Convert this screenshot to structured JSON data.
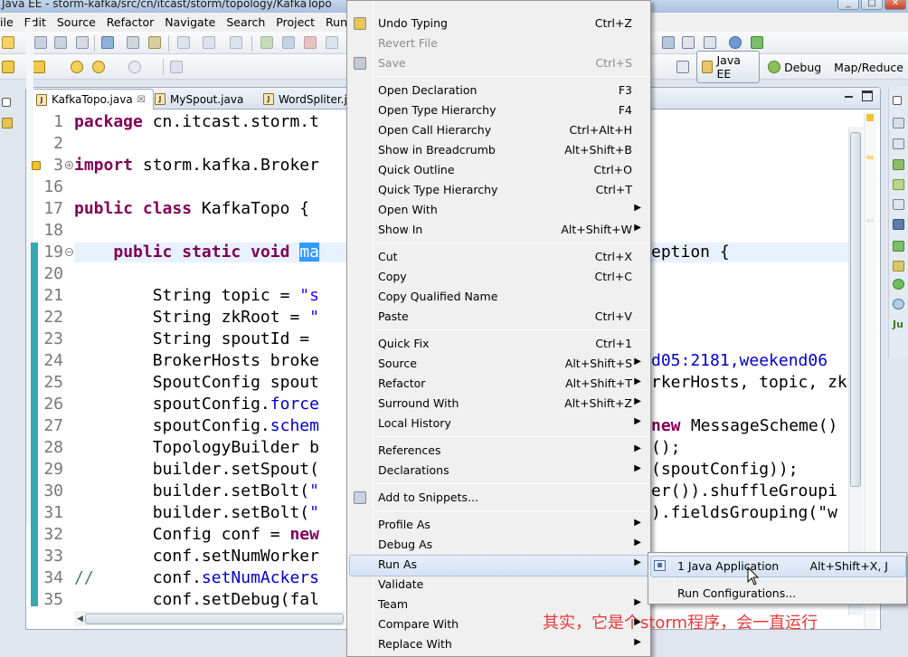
{
  "window": {
    "title": "Java EE - storm-kafka/src/cn/itcast/storm/topology/KafkaTopo"
  },
  "menubar": [
    "ile",
    "Edit",
    "Source",
    "Refactor",
    "Navigate",
    "Search",
    "Project",
    "Run"
  ],
  "perspectives": [
    {
      "label": "Java EE",
      "active": true,
      "icon": "java-ee-perspective-icon"
    },
    {
      "label": "Debug",
      "active": false,
      "icon": "debug-perspective-icon"
    },
    {
      "label": "Map/Reduce",
      "active": false,
      "icon": ""
    }
  ],
  "tabs": [
    {
      "label": "KafkaTopo.java",
      "active": true,
      "close": "☒"
    },
    {
      "label": "MySpout.java",
      "active": false
    },
    {
      "label": "WordSpliter.jav",
      "active": false
    }
  ],
  "editor": {
    "lines": [
      {
        "n": "1",
        "text": "package cn.itcast.storm.t"
      },
      {
        "n": "2",
        "text": ""
      },
      {
        "n": "3",
        "text": "import storm.kafka.Broker"
      },
      {
        "n": "16",
        "text": ""
      },
      {
        "n": "17",
        "text": "public class KafkaTopo {"
      },
      {
        "n": "18",
        "text": ""
      },
      {
        "n": "19",
        "text": "    public static void ma"
      },
      {
        "n": "20",
        "text": ""
      },
      {
        "n": "21",
        "text": "        String topic = \"s"
      },
      {
        "n": "22",
        "text": "        String zkRoot = \""
      },
      {
        "n": "23",
        "text": "        String spoutId = "
      },
      {
        "n": "24",
        "text": "        BrokerHosts broke"
      },
      {
        "n": "25",
        "text": "        SpoutConfig spout"
      },
      {
        "n": "26",
        "text": "        spoutConfig.force"
      },
      {
        "n": "27",
        "text": "        spoutConfig.schem"
      },
      {
        "n": "28",
        "text": "        TopologyBuilder b"
      },
      {
        "n": "29",
        "text": "        builder.setSpout("
      },
      {
        "n": "30",
        "text": "        builder.setBolt(\""
      },
      {
        "n": "31",
        "text": "        builder.setBolt(\""
      },
      {
        "n": "32",
        "text": "        Config conf = new"
      },
      {
        "n": "33",
        "text": "        conf.setNumWorker"
      },
      {
        "n": "34",
        "text": "//      conf.setNumAckers"
      },
      {
        "n": "35",
        "text": "        conf.setDebug(fal"
      }
    ],
    "right_fragments": {
      "l19": "eption {",
      "l24": "d05:2181,weekend06",
      "l25": "rkerHosts, topic, zk",
      "l27_kw": "new",
      "l27": " MessageScheme()",
      "l28": "();",
      "l29": "(spoutConfig));",
      "l30": "er()).shuffleGroupi",
      "l31": ").fieldsGrouping(\"w"
    }
  },
  "context_menu": {
    "items": [
      {
        "label": "Undo Typing",
        "accel": "Ctrl+Z",
        "icon": "undo-icon"
      },
      {
        "label": "Revert File",
        "disabled": true
      },
      {
        "label": "Save",
        "accel": "Ctrl+S",
        "disabled": true,
        "icon": "save-icon"
      },
      {
        "sep": true
      },
      {
        "label": "Open Declaration",
        "accel": "F3"
      },
      {
        "label": "Open Type Hierarchy",
        "accel": "F4"
      },
      {
        "label": "Open Call Hierarchy",
        "accel": "Ctrl+Alt+H"
      },
      {
        "label": "Show in Breadcrumb",
        "accel": "Alt+Shift+B"
      },
      {
        "label": "Quick Outline",
        "accel": "Ctrl+O"
      },
      {
        "label": "Quick Type Hierarchy",
        "accel": "Ctrl+T"
      },
      {
        "label": "Open With",
        "submenu": true
      },
      {
        "label": "Show In",
        "accel": "Alt+Shift+W",
        "submenu": true
      },
      {
        "sep": true
      },
      {
        "label": "Cut",
        "accel": "Ctrl+X"
      },
      {
        "label": "Copy",
        "accel": "Ctrl+C"
      },
      {
        "label": "Copy Qualified Name"
      },
      {
        "label": "Paste",
        "accel": "Ctrl+V"
      },
      {
        "sep": true
      },
      {
        "label": "Quick Fix",
        "accel": "Ctrl+1"
      },
      {
        "label": "Source",
        "accel": "Alt+Shift+S",
        "submenu": true
      },
      {
        "label": "Refactor",
        "accel": "Alt+Shift+T",
        "submenu": true
      },
      {
        "label": "Surround With",
        "accel": "Alt+Shift+Z",
        "submenu": true
      },
      {
        "label": "Local History",
        "submenu": true
      },
      {
        "sep": true
      },
      {
        "label": "References",
        "submenu": true
      },
      {
        "label": "Declarations",
        "submenu": true
      },
      {
        "sep": true
      },
      {
        "label": "Add to Snippets...",
        "icon": "snippets-icon"
      },
      {
        "sep": true
      },
      {
        "label": "Profile As",
        "submenu": true
      },
      {
        "label": "Debug As",
        "submenu": true
      },
      {
        "label": "Run As",
        "submenu": true,
        "highlighted": true
      },
      {
        "label": "Validate"
      },
      {
        "label": "Team",
        "submenu": true
      },
      {
        "label": "Compare With",
        "submenu": true
      },
      {
        "label": "Replace With",
        "submenu": true
      }
    ]
  },
  "run_as_submenu": {
    "items": [
      {
        "label": "1 Java Application",
        "accel": "Alt+Shift+X, J",
        "highlighted": true,
        "icon": "java-application-icon"
      },
      {
        "label": "Run Configurations..."
      }
    ]
  },
  "subtitle": "其实，它是个storm程序，会一直运行",
  "colors": {
    "selection": "#3399ff",
    "keyword": "#7f0055",
    "string": "#2a00ff",
    "field": "#0000c0",
    "quickdiff": "#35a9ad",
    "subtitle": "#e23a3a"
  }
}
